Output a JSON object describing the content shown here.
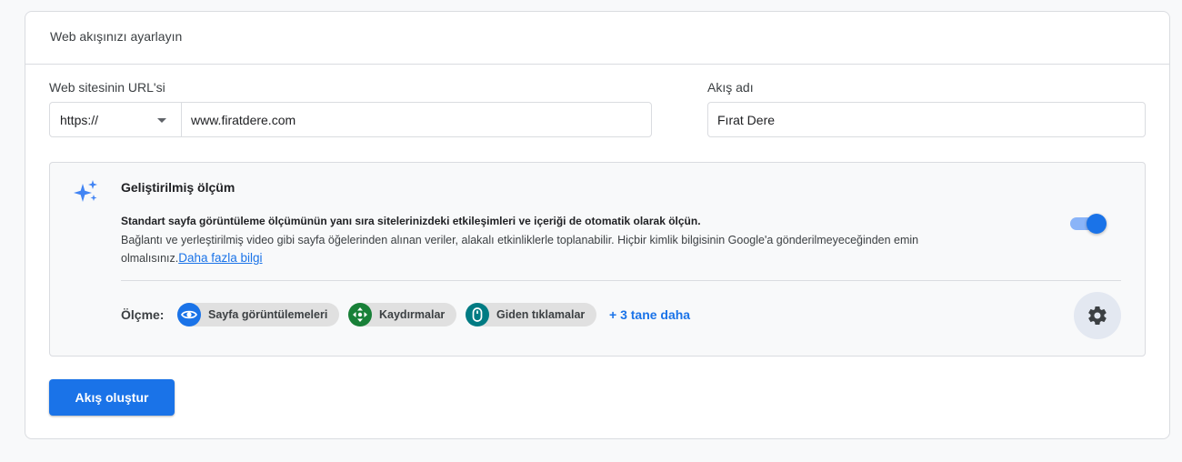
{
  "card": {
    "title": "Web akışınızı ayarlayın"
  },
  "form": {
    "url_label": "Web sitesinin URL'si",
    "protocol": "https://",
    "url_value": "www.firatdere.com",
    "stream_name_label": "Akış adı",
    "stream_name_value": "Fırat Dere"
  },
  "enhanced": {
    "title": "Geliştirilmiş ölçüm",
    "description_bold": "Standart sayfa görüntüleme ölçümünün yanı sıra sitelerinizdeki etkileşimleri ve içeriği de otomatik olarak ölçün.",
    "description": "Bağlantı ve yerleştirilmiş video gibi sayfa öğelerinden alınan veriler, alakalı etkinliklerle toplanabilir. Hiçbir kimlik bilgisinin Google'a gönderilmeyeceğinden emin olmalısınız.",
    "learn_more": "Daha fazla bilgi",
    "enabled": true,
    "measuring_label": "Ölçme:",
    "chips": [
      {
        "label": "Sayfa görüntülemeleri",
        "icon": "eye-icon",
        "color": "#1a73e8"
      },
      {
        "label": "Kaydırmalar",
        "icon": "scroll-icon",
        "color": "#188038"
      },
      {
        "label": "Giden tıklamalar",
        "icon": "mouse-icon",
        "color": "#007b83"
      }
    ],
    "more": "+ 3 tane daha"
  },
  "actions": {
    "create_label": "Akış oluştur"
  }
}
